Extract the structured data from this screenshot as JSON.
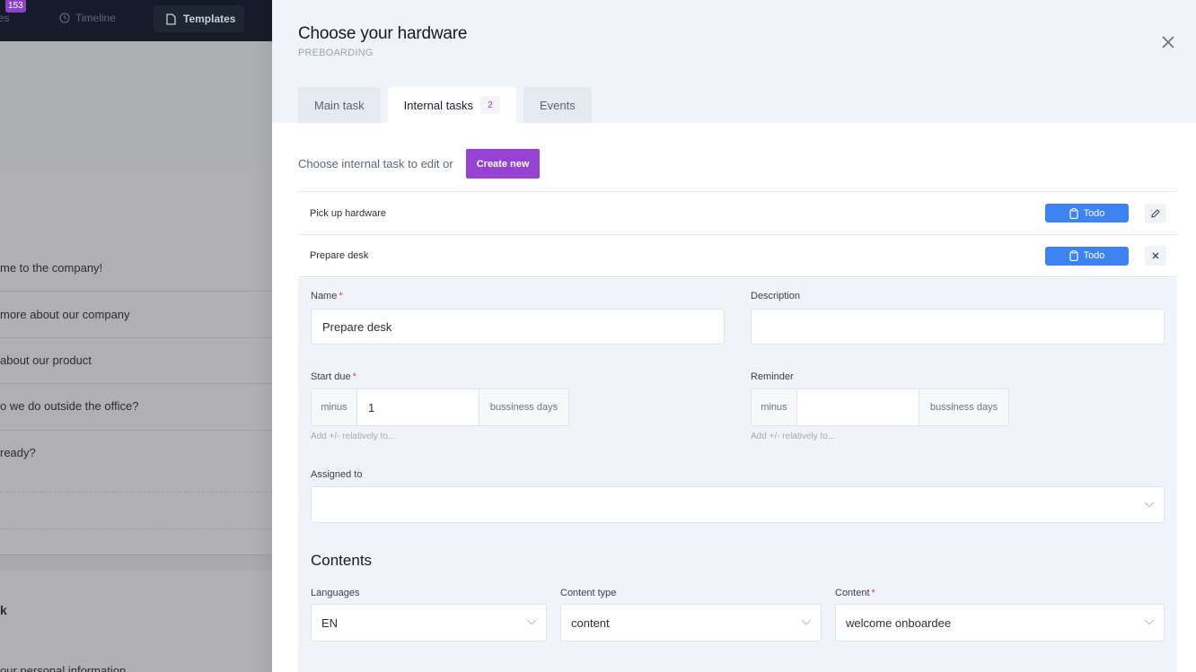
{
  "background": {
    "badge_count": "153",
    "nav_partial_label": "es",
    "nav_timeline": "Timeline",
    "nav_templates": "Templates",
    "list_items": [
      "me to the company!",
      "more about our company",
      "about our product",
      "o we do outside the office?",
      " ready?"
    ],
    "lower_heading": "k",
    "lower_item": "our personal information"
  },
  "modal": {
    "title": "Choose your hardware",
    "subtitle": "PREBOARDING",
    "close_icon": "close-icon",
    "tabs": [
      {
        "label": "Main task",
        "active": false
      },
      {
        "label": "Internal tasks",
        "active": true,
        "count": "2"
      },
      {
        "label": "Events",
        "active": false
      }
    ],
    "choose_text": "Choose internal task to edit or",
    "create_new_label": "Create new",
    "tasks": [
      {
        "name": "Pick up hardware",
        "status": "Todo",
        "action_icon": "pencil-icon"
      },
      {
        "name": "Prepare desk",
        "status": "Todo",
        "action_icon": "close-icon"
      }
    ],
    "form": {
      "name_label": "Name",
      "name_value": "Prepare desk",
      "description_label": "Description",
      "description_value": "",
      "start_due_label": "Start due",
      "start_due_prefix": "minus",
      "start_due_value": "1",
      "start_due_suffix": "bussiness days",
      "start_due_hint": "Add +/- relatively to...",
      "reminder_label": "Reminder",
      "reminder_prefix": "minus",
      "reminder_value": "",
      "reminder_suffix": "bussiness days",
      "reminder_hint": "Add +/- relatively to...",
      "assigned_label": "Assigned to",
      "assigned_value": "",
      "required_mark": "*",
      "contents_title": "Contents",
      "languages_label": "Languages",
      "languages_value": "EN",
      "content_type_label": "Content type",
      "content_type_value": "content",
      "content_label": "Content",
      "content_value": "welcome onboardee"
    }
  },
  "colors": {
    "accent_purple": "#9643d4",
    "todo_blue": "#3d83f1",
    "required_red": "#e0394c",
    "topbar_dark": "#151b28"
  }
}
